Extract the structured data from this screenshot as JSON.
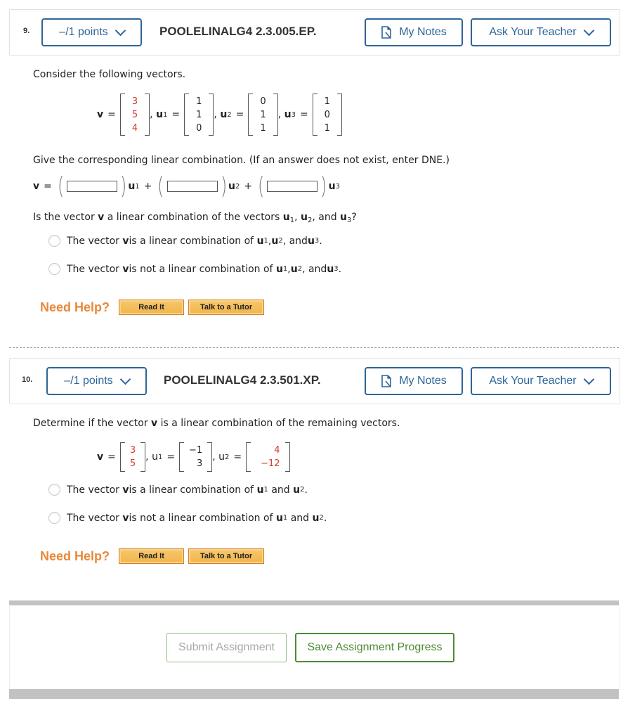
{
  "questions": [
    {
      "number": "9.",
      "points_label": "–/1 points",
      "code": "POOLELINALG4 2.3.005.EP.",
      "my_notes_label": "My Notes",
      "ask_teacher_label": "Ask Your Teacher",
      "prompt": "Consider the following vectors.",
      "vectors": [
        {
          "name": "v",
          "sub": "",
          "entries": [
            "3",
            "5",
            "4"
          ],
          "highlight": true
        },
        {
          "name": "u",
          "sub": "1",
          "entries": [
            "1",
            "1",
            "0"
          ],
          "highlight": false
        },
        {
          "name": "u",
          "sub": "2",
          "entries": [
            "0",
            "1",
            "1"
          ],
          "highlight": false
        },
        {
          "name": "u",
          "sub": "3",
          "entries": [
            "1",
            "0",
            "1"
          ],
          "highlight": false
        }
      ],
      "instruction": "Give the corresponding linear combination. (If an answer does not exist, enter DNE.)",
      "combination": {
        "lhs": "v",
        "terms": [
          {
            "coef_value": "",
            "vec": "u",
            "sub": "1"
          },
          {
            "coef_value": "",
            "vec": "u",
            "sub": "2"
          },
          {
            "coef_value": "",
            "vec": "u",
            "sub": "3"
          }
        ]
      },
      "question_text": {
        "pre": "Is the vector ",
        "v": "v",
        "mid": " a linear combination of the vectors ",
        "end": "?"
      },
      "options": [
        {
          "pre": "The vector ",
          "v": "v",
          "mid": " is a linear combination of ",
          "selected": false
        },
        {
          "pre": "The vector ",
          "v": "v",
          "mid": " is not a linear combination of ",
          "selected": false
        }
      ],
      "need_help_label": "Need Help?",
      "read_it_label": "Read It",
      "tutor_label": "Talk to a Tutor"
    },
    {
      "number": "10.",
      "points_label": "–/1 points",
      "code": "POOLELINALG4 2.3.501.XP.",
      "my_notes_label": "My Notes",
      "ask_teacher_label": "Ask Your Teacher",
      "prompt_pre": "Determine if the vector ",
      "prompt_v": "v",
      "prompt_post": " is a linear combination of the remaining vectors.",
      "vectors": [
        {
          "name": "v",
          "sub": "",
          "entries": [
            "3",
            "5"
          ]
        },
        {
          "name": "u",
          "sub": "1",
          "entries": [
            "−1",
            "3"
          ]
        },
        {
          "name": "u",
          "sub": "2",
          "entries": [
            "4",
            "−12"
          ]
        }
      ],
      "options": [
        {
          "pre": "The vector ",
          "v": "v",
          "mid": " is a linear combination of ",
          "selected": false
        },
        {
          "pre": "The vector ",
          "v": "v",
          "mid": " is not a linear combination of ",
          "selected": false
        }
      ],
      "need_help_label": "Need Help?",
      "read_it_label": "Read It",
      "tutor_label": "Talk to a Tutor"
    }
  ],
  "footer": {
    "submit_label": "Submit Assignment",
    "save_label": "Save Assignment Progress"
  },
  "colors": {
    "primary_blue": "#2e6598",
    "highlight_red": "#d33a2f",
    "help_orange": "#e8893a",
    "save_green": "#4e8a34"
  }
}
